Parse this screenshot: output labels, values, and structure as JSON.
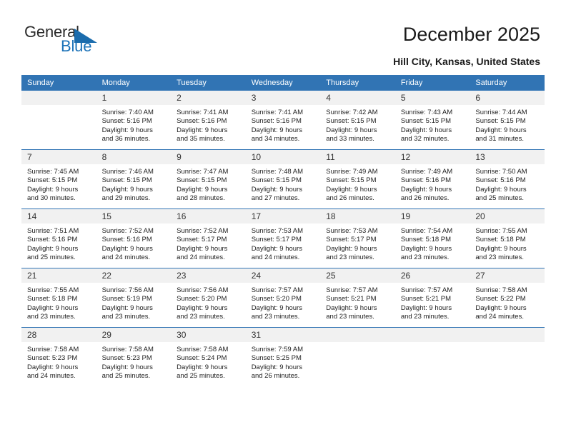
{
  "brand": {
    "name_part1": "General",
    "name_part2": "Blue",
    "accent_color": "#1b72b8"
  },
  "header": {
    "title": "December 2025",
    "location": "Hill City, Kansas, United States"
  },
  "calendar": {
    "header_bg": "#3174b4",
    "weekday_headers": [
      "Sunday",
      "Monday",
      "Tuesday",
      "Wednesday",
      "Thursday",
      "Friday",
      "Saturday"
    ],
    "weeks": [
      [
        {
          "day": "",
          "blank": true,
          "sunrise": "",
          "sunset": "",
          "daylight1": "",
          "daylight2": ""
        },
        {
          "day": "1",
          "sunrise": "Sunrise: 7:40 AM",
          "sunset": "Sunset: 5:16 PM",
          "daylight1": "Daylight: 9 hours",
          "daylight2": "and 36 minutes."
        },
        {
          "day": "2",
          "sunrise": "Sunrise: 7:41 AM",
          "sunset": "Sunset: 5:16 PM",
          "daylight1": "Daylight: 9 hours",
          "daylight2": "and 35 minutes."
        },
        {
          "day": "3",
          "sunrise": "Sunrise: 7:41 AM",
          "sunset": "Sunset: 5:16 PM",
          "daylight1": "Daylight: 9 hours",
          "daylight2": "and 34 minutes."
        },
        {
          "day": "4",
          "sunrise": "Sunrise: 7:42 AM",
          "sunset": "Sunset: 5:15 PM",
          "daylight1": "Daylight: 9 hours",
          "daylight2": "and 33 minutes."
        },
        {
          "day": "5",
          "sunrise": "Sunrise: 7:43 AM",
          "sunset": "Sunset: 5:15 PM",
          "daylight1": "Daylight: 9 hours",
          "daylight2": "and 32 minutes."
        },
        {
          "day": "6",
          "sunrise": "Sunrise: 7:44 AM",
          "sunset": "Sunset: 5:15 PM",
          "daylight1": "Daylight: 9 hours",
          "daylight2": "and 31 minutes."
        }
      ],
      [
        {
          "day": "7",
          "sunrise": "Sunrise: 7:45 AM",
          "sunset": "Sunset: 5:15 PM",
          "daylight1": "Daylight: 9 hours",
          "daylight2": "and 30 minutes."
        },
        {
          "day": "8",
          "sunrise": "Sunrise: 7:46 AM",
          "sunset": "Sunset: 5:15 PM",
          "daylight1": "Daylight: 9 hours",
          "daylight2": "and 29 minutes."
        },
        {
          "day": "9",
          "sunrise": "Sunrise: 7:47 AM",
          "sunset": "Sunset: 5:15 PM",
          "daylight1": "Daylight: 9 hours",
          "daylight2": "and 28 minutes."
        },
        {
          "day": "10",
          "sunrise": "Sunrise: 7:48 AM",
          "sunset": "Sunset: 5:15 PM",
          "daylight1": "Daylight: 9 hours",
          "daylight2": "and 27 minutes."
        },
        {
          "day": "11",
          "sunrise": "Sunrise: 7:49 AM",
          "sunset": "Sunset: 5:15 PM",
          "daylight1": "Daylight: 9 hours",
          "daylight2": "and 26 minutes."
        },
        {
          "day": "12",
          "sunrise": "Sunrise: 7:49 AM",
          "sunset": "Sunset: 5:16 PM",
          "daylight1": "Daylight: 9 hours",
          "daylight2": "and 26 minutes."
        },
        {
          "day": "13",
          "sunrise": "Sunrise: 7:50 AM",
          "sunset": "Sunset: 5:16 PM",
          "daylight1": "Daylight: 9 hours",
          "daylight2": "and 25 minutes."
        }
      ],
      [
        {
          "day": "14",
          "sunrise": "Sunrise: 7:51 AM",
          "sunset": "Sunset: 5:16 PM",
          "daylight1": "Daylight: 9 hours",
          "daylight2": "and 25 minutes."
        },
        {
          "day": "15",
          "sunrise": "Sunrise: 7:52 AM",
          "sunset": "Sunset: 5:16 PM",
          "daylight1": "Daylight: 9 hours",
          "daylight2": "and 24 minutes."
        },
        {
          "day": "16",
          "sunrise": "Sunrise: 7:52 AM",
          "sunset": "Sunset: 5:17 PM",
          "daylight1": "Daylight: 9 hours",
          "daylight2": "and 24 minutes."
        },
        {
          "day": "17",
          "sunrise": "Sunrise: 7:53 AM",
          "sunset": "Sunset: 5:17 PM",
          "daylight1": "Daylight: 9 hours",
          "daylight2": "and 24 minutes."
        },
        {
          "day": "18",
          "sunrise": "Sunrise: 7:53 AM",
          "sunset": "Sunset: 5:17 PM",
          "daylight1": "Daylight: 9 hours",
          "daylight2": "and 23 minutes."
        },
        {
          "day": "19",
          "sunrise": "Sunrise: 7:54 AM",
          "sunset": "Sunset: 5:18 PM",
          "daylight1": "Daylight: 9 hours",
          "daylight2": "and 23 minutes."
        },
        {
          "day": "20",
          "sunrise": "Sunrise: 7:55 AM",
          "sunset": "Sunset: 5:18 PM",
          "daylight1": "Daylight: 9 hours",
          "daylight2": "and 23 minutes."
        }
      ],
      [
        {
          "day": "21",
          "sunrise": "Sunrise: 7:55 AM",
          "sunset": "Sunset: 5:18 PM",
          "daylight1": "Daylight: 9 hours",
          "daylight2": "and 23 minutes."
        },
        {
          "day": "22",
          "sunrise": "Sunrise: 7:56 AM",
          "sunset": "Sunset: 5:19 PM",
          "daylight1": "Daylight: 9 hours",
          "daylight2": "and 23 minutes."
        },
        {
          "day": "23",
          "sunrise": "Sunrise: 7:56 AM",
          "sunset": "Sunset: 5:20 PM",
          "daylight1": "Daylight: 9 hours",
          "daylight2": "and 23 minutes."
        },
        {
          "day": "24",
          "sunrise": "Sunrise: 7:57 AM",
          "sunset": "Sunset: 5:20 PM",
          "daylight1": "Daylight: 9 hours",
          "daylight2": "and 23 minutes."
        },
        {
          "day": "25",
          "sunrise": "Sunrise: 7:57 AM",
          "sunset": "Sunset: 5:21 PM",
          "daylight1": "Daylight: 9 hours",
          "daylight2": "and 23 minutes."
        },
        {
          "day": "26",
          "sunrise": "Sunrise: 7:57 AM",
          "sunset": "Sunset: 5:21 PM",
          "daylight1": "Daylight: 9 hours",
          "daylight2": "and 23 minutes."
        },
        {
          "day": "27",
          "sunrise": "Sunrise: 7:58 AM",
          "sunset": "Sunset: 5:22 PM",
          "daylight1": "Daylight: 9 hours",
          "daylight2": "and 24 minutes."
        }
      ],
      [
        {
          "day": "28",
          "sunrise": "Sunrise: 7:58 AM",
          "sunset": "Sunset: 5:23 PM",
          "daylight1": "Daylight: 9 hours",
          "daylight2": "and 24 minutes."
        },
        {
          "day": "29",
          "sunrise": "Sunrise: 7:58 AM",
          "sunset": "Sunset: 5:23 PM",
          "daylight1": "Daylight: 9 hours",
          "daylight2": "and 25 minutes."
        },
        {
          "day": "30",
          "sunrise": "Sunrise: 7:58 AM",
          "sunset": "Sunset: 5:24 PM",
          "daylight1": "Daylight: 9 hours",
          "daylight2": "and 25 minutes."
        },
        {
          "day": "31",
          "sunrise": "Sunrise: 7:59 AM",
          "sunset": "Sunset: 5:25 PM",
          "daylight1": "Daylight: 9 hours",
          "daylight2": "and 26 minutes."
        },
        {
          "day": "",
          "blank": true,
          "sunrise": "",
          "sunset": "",
          "daylight1": "",
          "daylight2": ""
        },
        {
          "day": "",
          "blank": true,
          "sunrise": "",
          "sunset": "",
          "daylight1": "",
          "daylight2": ""
        },
        {
          "day": "",
          "blank": true,
          "sunrise": "",
          "sunset": "",
          "daylight1": "",
          "daylight2": ""
        }
      ]
    ]
  }
}
